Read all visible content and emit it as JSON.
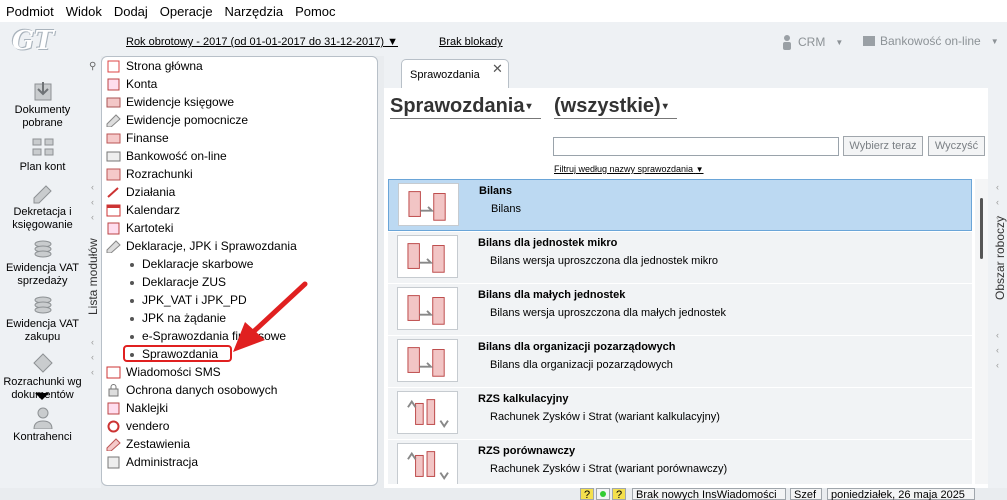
{
  "menu": [
    "Podmiot",
    "Widok",
    "Dodaj",
    "Operacje",
    "Narzędzia",
    "Pomoc"
  ],
  "logo": "GT",
  "year_selector": "Rok obrotowy - 2017  (od 01-01-2017 do 31-12-2017)",
  "lock_status": "Brak blokady",
  "top_right": {
    "crm": "CRM",
    "bank": "Bankowość on-line"
  },
  "left_bar": [
    {
      "label": "Dokumenty pobrane",
      "icon": "download-documents-icon"
    },
    {
      "label": "Plan kont",
      "icon": "chart-of-accounts-icon"
    },
    {
      "label": "Dekretacja i księgowanie",
      "icon": "posting-icon"
    },
    {
      "label": "Ewidencja VAT sprzedaży",
      "icon": "vat-sales-icon"
    },
    {
      "label": "Ewidencja VAT zakupu",
      "icon": "vat-purchase-icon"
    },
    {
      "label": "Rozrachunki wg dokumentów",
      "icon": "settlements-icon"
    },
    {
      "label": "Kontrahenci",
      "icon": "contractors-icon"
    }
  ],
  "modules_label": "Lista modułów",
  "tree": [
    {
      "label": "Strona główna",
      "icon": "home-icon"
    },
    {
      "label": "Konta",
      "icon": "accounts-icon"
    },
    {
      "label": "Ewidencje księgowe",
      "icon": "ledger-icon"
    },
    {
      "label": "Ewidencje pomocnicze",
      "icon": "auxiliary-records-icon"
    },
    {
      "label": "Finanse",
      "icon": "finance-icon"
    },
    {
      "label": "Bankowość on-line",
      "icon": "online-banking-icon"
    },
    {
      "label": "Rozrachunki",
      "icon": "settlements-icon"
    },
    {
      "label": "Działania",
      "icon": "actions-icon"
    },
    {
      "label": "Kalendarz",
      "icon": "calendar-icon"
    },
    {
      "label": "Kartoteki",
      "icon": "files-icon"
    },
    {
      "label": "Deklaracje, JPK i Sprawozdania",
      "icon": "declarations-icon"
    }
  ],
  "subtree": [
    "Deklaracje skarbowe",
    "Deklaracje ZUS",
    "JPK_VAT i JPK_PD",
    "JPK na żądanie",
    "e-Sprawozdania finansowe",
    "Sprawozdania"
  ],
  "tree2": [
    {
      "label": "Wiadomości SMS",
      "icon": "sms-icon"
    },
    {
      "label": "Ochrona danych osobowych",
      "icon": "data-protection-icon"
    },
    {
      "label": "Naklejki",
      "icon": "labels-icon"
    },
    {
      "label": "vendero",
      "icon": "vendero-icon"
    },
    {
      "label": "Zestawienia",
      "icon": "reports-icon"
    },
    {
      "label": "Administracja",
      "icon": "administration-icon"
    }
  ],
  "tab": "Sprawozdania",
  "heading": {
    "title": "Sprawozdania",
    "filter": "(wszystkie)"
  },
  "search": {
    "value": "",
    "placeholder": ""
  },
  "buttons": {
    "select": "Wybierz teraz",
    "clear": "Wyczyść"
  },
  "filter_link": "Filtruj według nazwy sprawozdania",
  "reports": [
    {
      "title": "Bilans",
      "desc": "Bilans",
      "icon": "balance-sheet-icon"
    },
    {
      "title": "Bilans dla jednostek mikro",
      "desc": "Bilans wersja uproszczona dla jednostek mikro",
      "icon": "balance-sheet-icon"
    },
    {
      "title": "Bilans dla małych jednostek",
      "desc": "Bilans wersja uproszczona dla małych jednostek",
      "icon": "balance-sheet-icon"
    },
    {
      "title": "Bilans dla organizacji pozarządowych",
      "desc": "Bilans dla organizacji pozarządowych",
      "icon": "balance-sheet-icon"
    },
    {
      "title": "RZS kalkulacyjny",
      "desc": "Rachunek Zysków i Strat (wariant kalkulacyjny)",
      "icon": "profit-loss-icon"
    },
    {
      "title": "RZS porównawczy",
      "desc": "Rachunek Zysków i Strat (wariant porównawczy)",
      "icon": "profit-loss-icon"
    }
  ],
  "work_area": "Obszar roboczy",
  "status": {
    "news": "Brak nowych InsWiadomości",
    "user": "Szef",
    "date": "poniedziałek, 26 maja 2025"
  },
  "colors": {
    "selected_row": "#bcd9f2",
    "highlight": "#e02020",
    "arrow": "#e02020"
  }
}
